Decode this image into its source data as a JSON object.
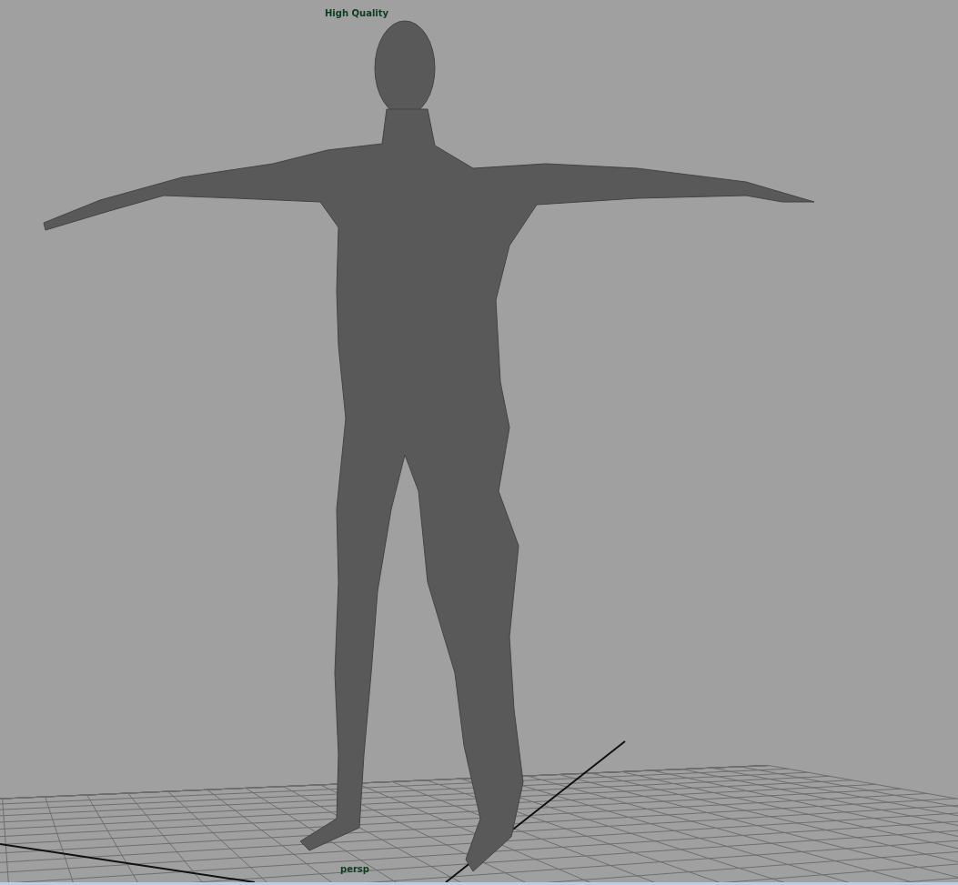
{
  "viewport": {
    "quality_label": "High Quality",
    "camera_label": "persp"
  }
}
